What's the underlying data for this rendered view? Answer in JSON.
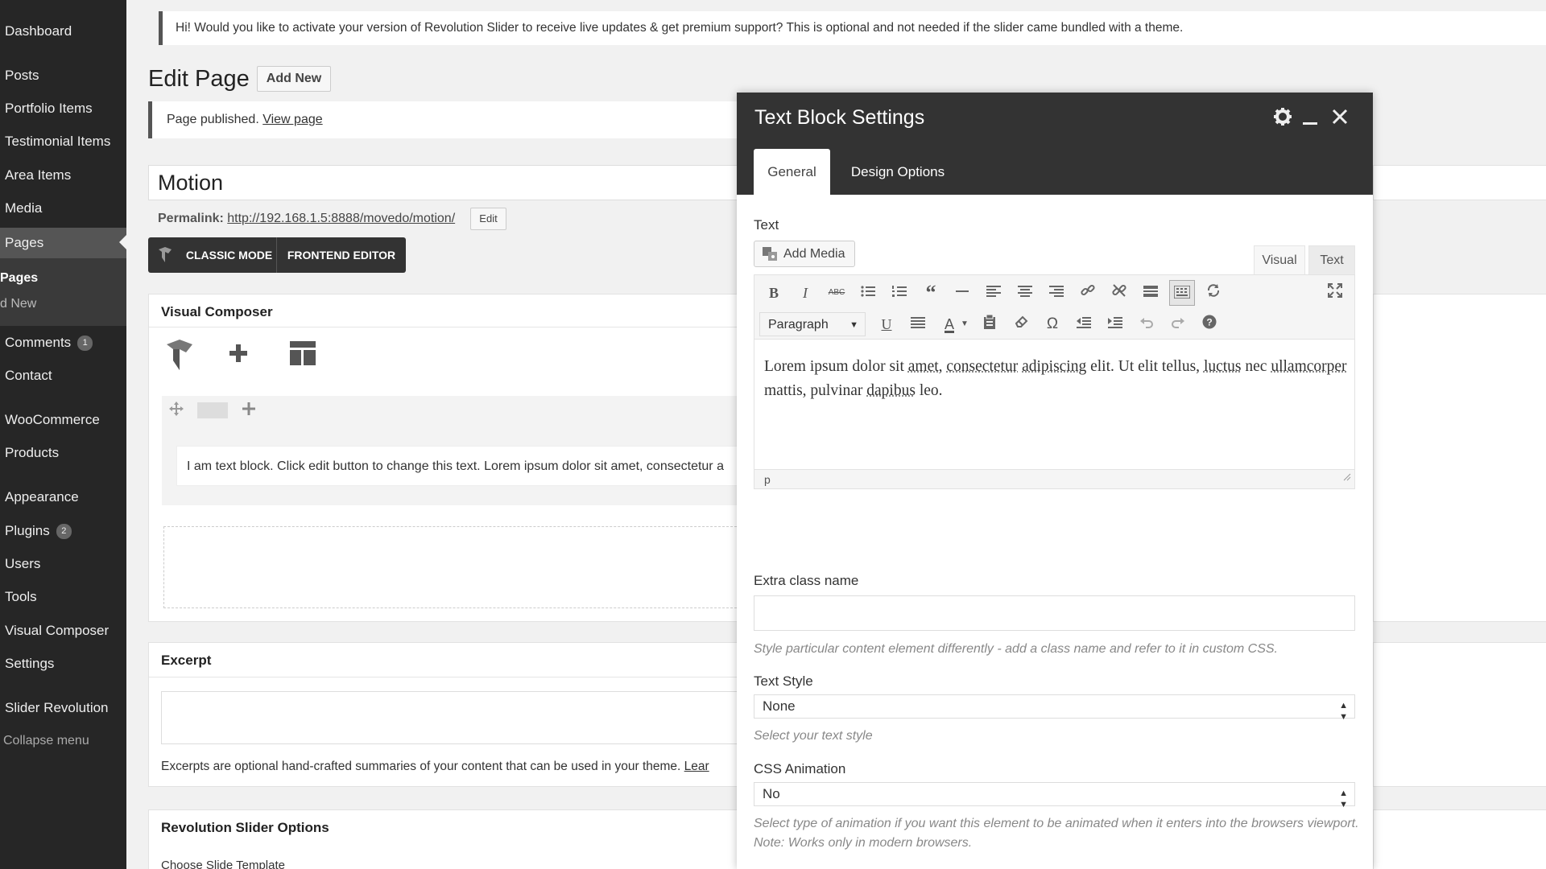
{
  "sidebar": {
    "items": [
      {
        "label": "Dashboard"
      },
      {
        "label": "Posts"
      },
      {
        "label": "Portfolio Items"
      },
      {
        "label": "Testimonial Items"
      },
      {
        "label": "Area Items"
      },
      {
        "label": "Media"
      },
      {
        "label": "Pages"
      },
      {
        "label": "Comments",
        "badge": "1"
      },
      {
        "label": "Contact"
      },
      {
        "label": "WooCommerce"
      },
      {
        "label": "Products"
      },
      {
        "label": "Appearance"
      },
      {
        "label": "Plugins",
        "badge": "2"
      },
      {
        "label": "Users"
      },
      {
        "label": "Tools"
      },
      {
        "label": "Visual Composer"
      },
      {
        "label": "Settings"
      },
      {
        "label": "Slider Revolution"
      }
    ],
    "submenu": {
      "heading": "Pages",
      "item": "d New"
    },
    "collapse_label": "Collapse menu"
  },
  "notices": {
    "revolution": "Hi! Would you like to activate your version of Revolution Slider to receive live updates & get premium support? This is optional and not needed if the slider came bundled with a theme.",
    "published_text": "Page published.",
    "published_link": "View page"
  },
  "page": {
    "heading": "Edit Page",
    "add_new": "Add New",
    "title_value": "Motion",
    "permalink_label": "Permalink:",
    "permalink_url": "http://192.168.1.5:8888/movedo/motion/",
    "permalink_edit": "Edit",
    "classic_mode": "CLASSIC MODE",
    "frontend_editor": "FRONTEND EDITOR"
  },
  "visual_composer": {
    "title": "Visual Composer",
    "text_block": "I am text block. Click edit button to change this text. Lorem ipsum dolor sit amet, consectetur a"
  },
  "excerpt": {
    "title": "Excerpt",
    "help": "Excerpts are optional hand-crafted summaries of your content that can be used in your theme.",
    "help_link": "Lear"
  },
  "revolution_options": {
    "title": "Revolution Slider Options",
    "choose_template": "Choose Slide Template"
  },
  "modal": {
    "title": "Text Block Settings",
    "tabs": {
      "general": "General",
      "design": "Design Options"
    },
    "text_label": "Text",
    "add_media": "Add Media",
    "editor_tabs": {
      "visual": "Visual",
      "text": "Text"
    },
    "format_select": "Paragraph",
    "editor_content": {
      "w1": "Lorem ipsum dolor sit ",
      "s1": "amet",
      "w2": ", ",
      "s2": "consectetur",
      "w3": " ",
      "s3": "adipiscing",
      "w4": " elit. Ut elit tellus, ",
      "s4": "luctus",
      "w5": " nec ",
      "s5": "ullamcorper",
      "w6": " mattis, pulvinar ",
      "s6": "dapibus",
      "w7": " leo."
    },
    "status_path": "p",
    "extra_class_label": "Extra class name",
    "extra_class_value": "",
    "extra_class_help": "Style particular content element differently - add a class name and refer to it in custom CSS.",
    "text_style_label": "Text Style",
    "text_style_value": "None",
    "text_style_help": "Select your text style",
    "css_animation_label": "CSS Animation",
    "css_animation_value": "No",
    "css_animation_help": "Select type of animation if you want this element to be animated when it enters into the browsers viewport. Note: Works only in modern browsers."
  }
}
